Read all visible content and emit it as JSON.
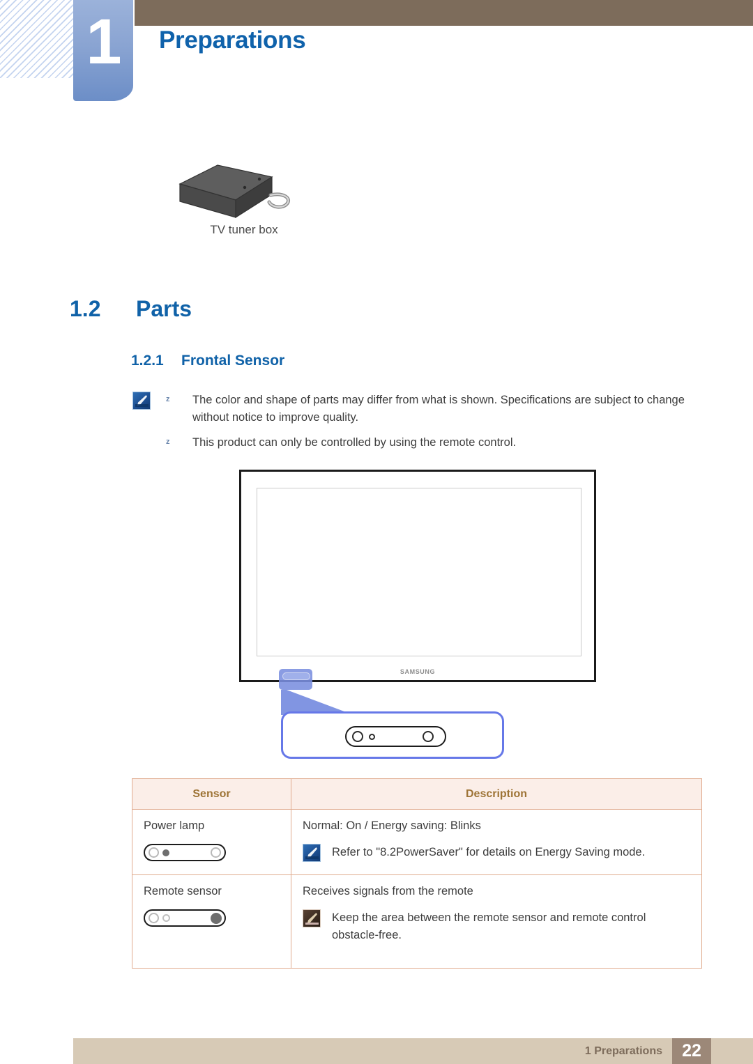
{
  "header": {
    "chapter_number": "1",
    "chapter_title": "Preparations"
  },
  "figure_tuner": {
    "caption": "TV tuner box",
    "icon": "tv-tuner-box-illustration"
  },
  "headings": {
    "section_number": "1.2",
    "section_title": "Parts",
    "subsection_number": "1.2.1",
    "subsection_title": "Frontal Sensor"
  },
  "notes": {
    "icon": "note-pen-icon",
    "bullet_mark": "z",
    "items": [
      "The color and shape of parts may differ from what is shown. Specifications are subject to change without notice to improve quality.",
      "This product can only be controlled by using the remote control."
    ]
  },
  "figure_monitor": {
    "brand_logo": "SAMSUNG",
    "highlight_label": "frontal-sensor-highlight",
    "callout_label": "frontal-sensor-closeup"
  },
  "table": {
    "columns": [
      "Sensor",
      "Description"
    ],
    "rows": [
      {
        "sensor": "Power lamp",
        "sensor_icon": "power-lamp-strip-icon",
        "description": "Normal: On / Energy saving: Blinks",
        "note_icon": "note-pen-icon",
        "note": "Refer to \"8.2PowerSaver\" for details on Energy Saving mode."
      },
      {
        "sensor": "Remote sensor",
        "sensor_icon": "remote-sensor-strip-icon",
        "description": "Receives signals from the remote",
        "note_icon": "note-pencil-icon",
        "note": "Keep the area between the remote sensor and remote control obstacle-free."
      }
    ]
  },
  "footer": {
    "label": "1 Preparations",
    "page_number": "22"
  },
  "colors": {
    "header_brown": "#7d6c5b",
    "tab_blue": "#7b9ad0",
    "heading_blue": "#1062a8",
    "table_header_bg": "#fbeee8",
    "table_header_text": "#9e7436",
    "table_border": "#e0ab8e",
    "footer_bar": "#d7cab6",
    "footer_page_bg": "#9c8878",
    "callout_blue": "#6678e8"
  }
}
